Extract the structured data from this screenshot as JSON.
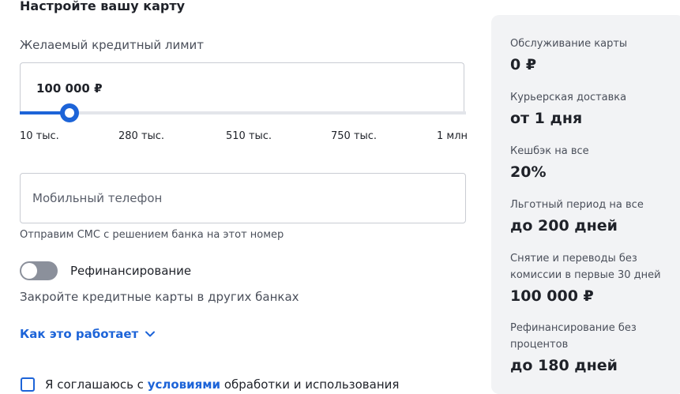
{
  "form": {
    "title": "Настройте вашу карту",
    "limit": {
      "label": "Желаемый кредитный лимит",
      "value_text": "100 000 ₽",
      "slider_fraction": 0.11,
      "ticks": [
        "10 тыс.",
        "280 тыс.",
        "510 тыс.",
        "750 тыс.",
        "1 млн"
      ]
    },
    "phone": {
      "placeholder": "Мобильный телефон",
      "value": "",
      "hint": "Отправим СМС с решением банка на этот номер"
    },
    "refinance": {
      "label": "Рефинансирование",
      "enabled": false,
      "description": "Закройте кредитные карты в других банках"
    },
    "how_it_works": "Как это работает",
    "agreement": {
      "before": "Я соглашаюсь с ",
      "link": "условиями",
      "after": " обработки и использования"
    }
  },
  "summary": {
    "items": [
      {
        "label": "Обслуживание карты",
        "value": "0 ₽"
      },
      {
        "label": "Курьерская доставка",
        "value": "от 1 дня"
      },
      {
        "label": "Кешбэк на все",
        "value": "20%"
      },
      {
        "label": "Льготный период на все",
        "value": "до 200 дней"
      },
      {
        "label": "Снятие и переводы без комиссии в первые 30 дней",
        "value": "100 000 ₽"
      },
      {
        "label": "Рефинансирование без процентов",
        "value": "до 180 дней"
      }
    ]
  },
  "colors": {
    "accent": "#1d64d8",
    "panel": "#f2f3f5",
    "toggle_off": "#8b909b",
    "border": "#c9ccd3"
  },
  "icons": {
    "how_it_works_chevron": "chevron-down-icon"
  }
}
